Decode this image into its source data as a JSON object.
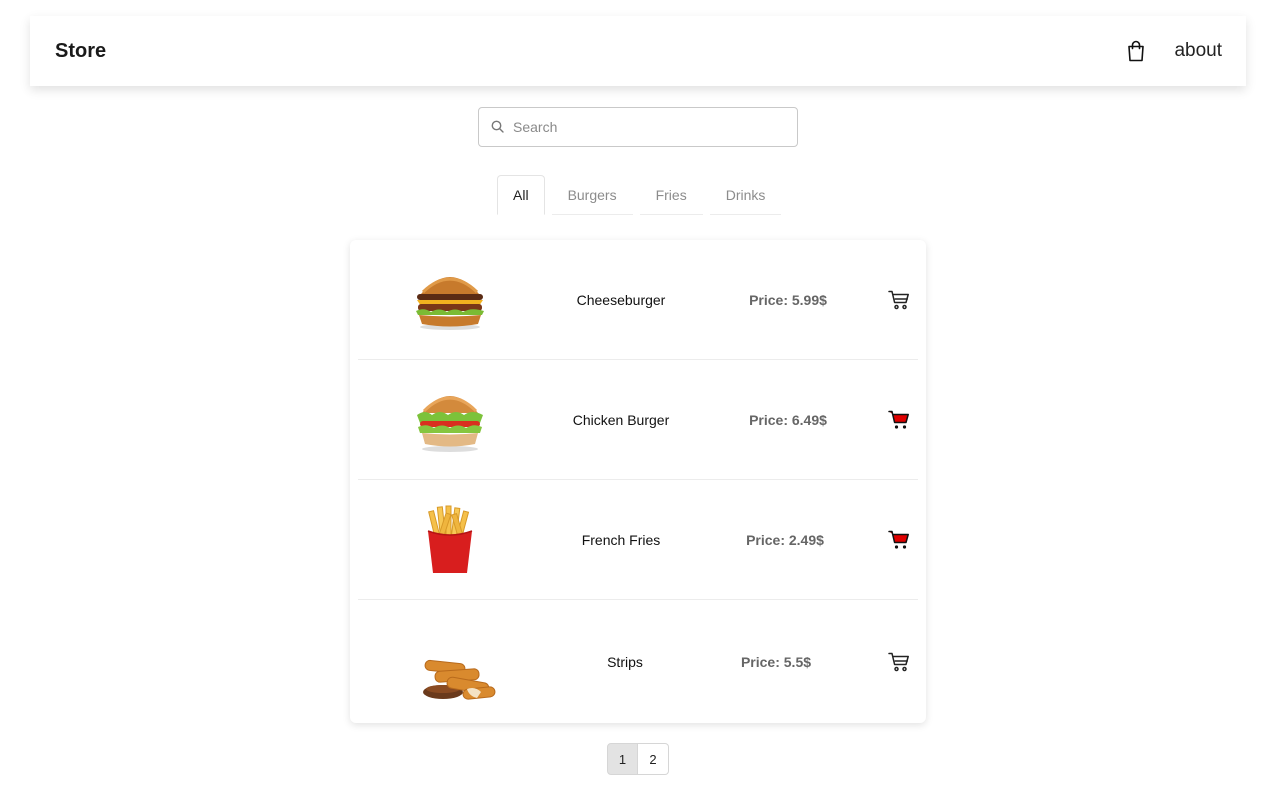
{
  "navbar": {
    "brand": "Store",
    "bag_icon": "shopping-bag-icon",
    "about_label": "about"
  },
  "search": {
    "icon": "search-icon",
    "placeholder": "Search",
    "value": ""
  },
  "tabs": [
    {
      "label": "All",
      "active": true
    },
    {
      "label": "Burgers",
      "active": false
    },
    {
      "label": "Fries",
      "active": false
    },
    {
      "label": "Drinks",
      "active": false
    }
  ],
  "products": [
    {
      "name": "Cheeseburger",
      "price": "Price: 5.99$",
      "image": "cheeseburger-image",
      "in_cart": false
    },
    {
      "name": "Chicken Burger",
      "price": "Price: 6.49$",
      "image": "chicken-burger-image",
      "in_cart": true
    },
    {
      "name": "French Fries",
      "price": "Price: 2.49$",
      "image": "french-fries-image",
      "in_cart": true
    },
    {
      "name": "Strips",
      "price": "Price: 5.5$",
      "image": "strips-image",
      "in_cart": false
    }
  ],
  "pagination": {
    "pages": [
      "1",
      "2"
    ],
    "current": "1"
  },
  "colors": {
    "cart_active": "#e00000",
    "cart_inactive": "#222222",
    "page_active_bg": "#e3e3e3"
  }
}
